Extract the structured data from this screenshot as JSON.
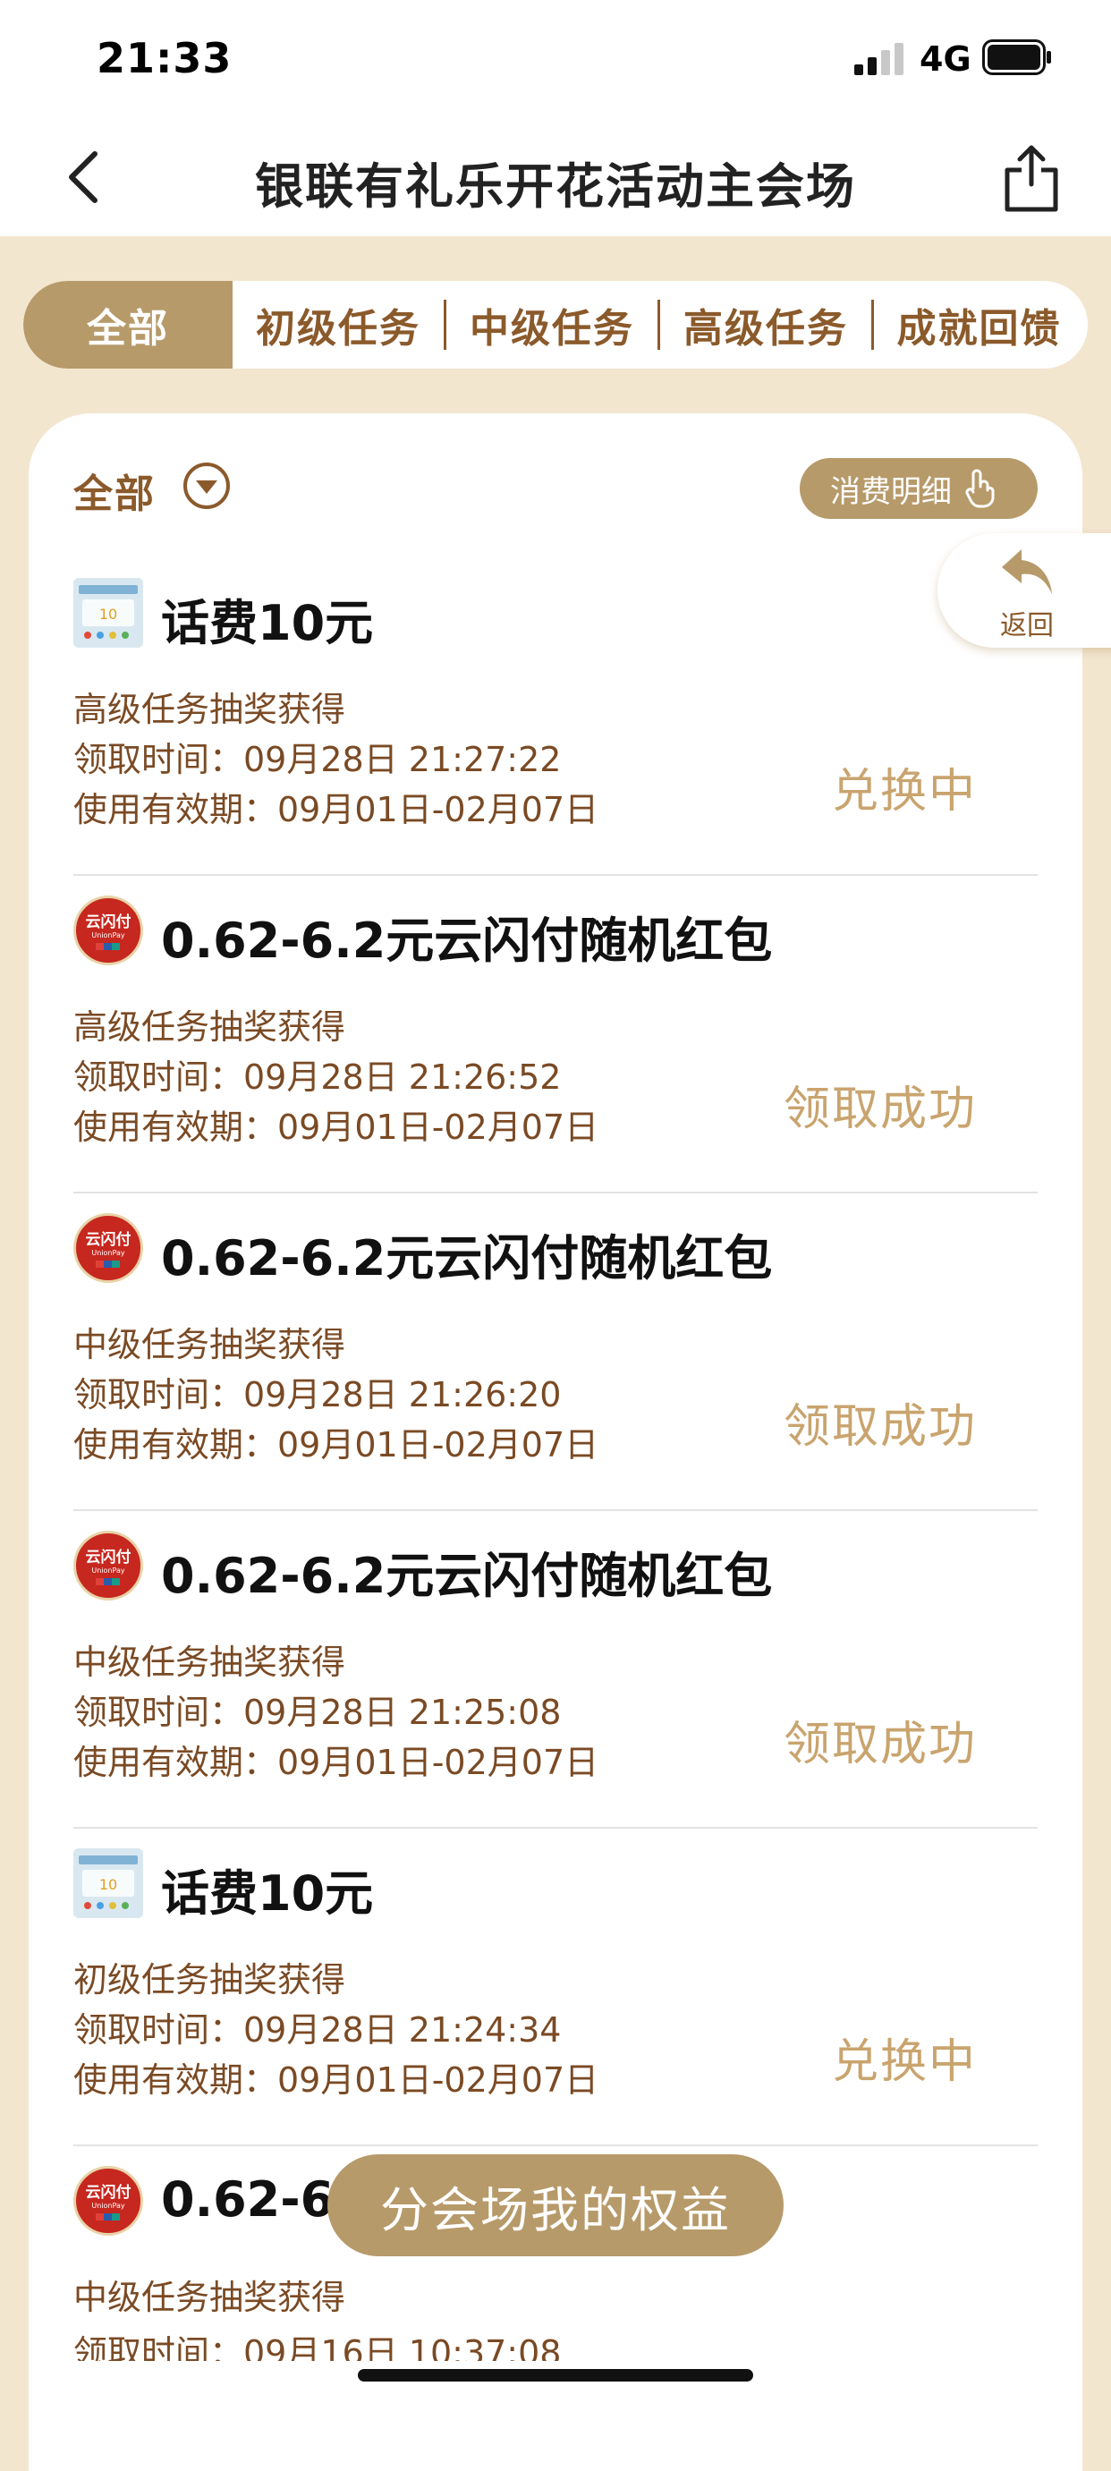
{
  "status_bar": {
    "time": "21:33",
    "network": "4G"
  },
  "nav": {
    "title": "银联有礼乐开花活动主会场"
  },
  "tabs": [
    {
      "label": "全部",
      "active": true
    },
    {
      "label": "初级任务",
      "active": false
    },
    {
      "label": "中级任务",
      "active": false
    },
    {
      "label": "高级任务",
      "active": false
    },
    {
      "label": "成就回馈",
      "active": false
    }
  ],
  "filter": {
    "label": "全部",
    "detail_button": "消费明细"
  },
  "float_back": {
    "label": "返回"
  },
  "records": [
    {
      "icon": "phone-credit-icon",
      "title": "话费10元",
      "source": "高级任务抽奖获得",
      "time": "领取时间：09月28日 21:27:22",
      "valid": "使用有效期：09月01日-02月07日",
      "status": "兑换中"
    },
    {
      "icon": "unionpay-icon",
      "title": "0.62-6.2元云闪付随机红包",
      "source": "高级任务抽奖获得",
      "time": "领取时间：09月28日 21:26:52",
      "valid": "使用有效期：09月01日-02月07日",
      "status": "领取成功"
    },
    {
      "icon": "unionpay-icon",
      "title": "0.62-6.2元云闪付随机红包",
      "source": "中级任务抽奖获得",
      "time": "领取时间：09月28日 21:26:20",
      "valid": "使用有效期：09月01日-02月07日",
      "status": "领取成功"
    },
    {
      "icon": "unionpay-icon",
      "title": "0.62-6.2元云闪付随机红包",
      "source": "中级任务抽奖获得",
      "time": "领取时间：09月28日 21:25:08",
      "valid": "使用有效期：09月01日-02月07日",
      "status": "领取成功"
    },
    {
      "icon": "phone-credit-icon",
      "title": "话费10元",
      "source": "初级任务抽奖获得",
      "time": "领取时间：09月28日 21:24:34",
      "valid": "使用有效期：09月01日-02月07日",
      "status": "兑换中"
    },
    {
      "icon": "unionpay-icon",
      "title": "0.62-6",
      "source": "中级任务抽奖获得",
      "time": "领取时间：09月16日 10:37:08",
      "valid": "",
      "status": ""
    }
  ],
  "bottom_button": {
    "label": "分会场我的权益"
  },
  "colors": {
    "accent": "#b79a6a",
    "brown_text": "#7a4a24",
    "status_text": "#c9a46e",
    "background": "#f3e6cf"
  }
}
